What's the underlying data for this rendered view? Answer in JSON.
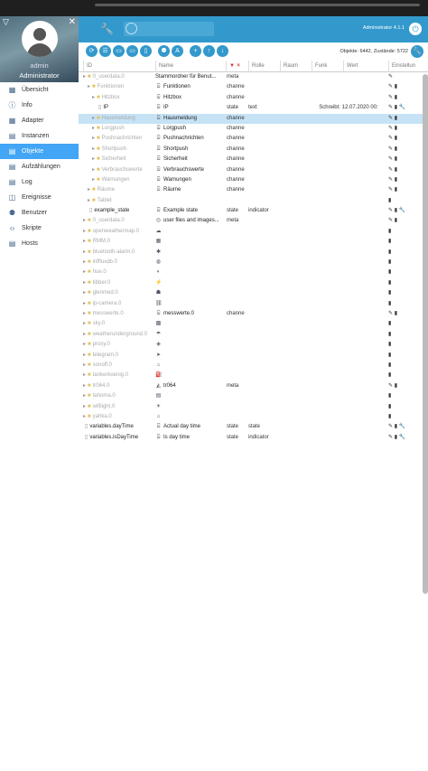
{
  "sidebar": {
    "user": "admin",
    "role": "Administrator",
    "items": [
      {
        "label": "Übersicht",
        "icon": "overview-icon"
      },
      {
        "label": "Info",
        "icon": "info-icon"
      },
      {
        "label": "Adapter",
        "icon": "adapter-icon"
      },
      {
        "label": "Instanzen",
        "icon": "instances-icon"
      },
      {
        "label": "Objekte",
        "icon": "objects-icon"
      },
      {
        "label": "Aufzählungen",
        "icon": "enums-icon"
      },
      {
        "label": "Log",
        "icon": "log-icon"
      },
      {
        "label": "Ereignisse",
        "icon": "events-icon"
      },
      {
        "label": "Benutzer",
        "icon": "users-icon"
      },
      {
        "label": "Skripte",
        "icon": "scripts-icon"
      },
      {
        "label": "Hosts",
        "icon": "hosts-icon"
      }
    ],
    "active_index": 4
  },
  "appbar": {
    "search_placeholder": "",
    "version": "Administrator 4.1.1"
  },
  "toolbar": {
    "object_count": "Objekte: 6442, Zustände: 5722"
  },
  "table": {
    "columns": [
      "ID",
      "Name",
      "▼ ✕",
      "Rolle",
      "Raum",
      "Funk",
      "Wert",
      "Einstellun"
    ],
    "rows": [
      {
        "id": "0_userdata.0",
        "name": "Stammordner für Benut...",
        "type": "meta",
        "role": "",
        "val": "",
        "acts": "✎"
      },
      {
        "id": "Funktionen",
        "name": "Funktionen",
        "type": "channe",
        "role": "",
        "val": "",
        "acts": "✎ ▮"
      },
      {
        "id": "Hitzbox",
        "name": "Hitzbox",
        "type": "channe",
        "role": "",
        "val": "",
        "acts": "✎ ▮"
      },
      {
        "id": "IP",
        "name": "IP",
        "type": "state",
        "role": "text",
        "val": "Schreibt: 12.07.2020 00:",
        "acts": "✎ ▮ 🔧"
      },
      {
        "id": "Hausmeldung",
        "name": "Hausmeldung",
        "type": "channe",
        "role": "",
        "val": "",
        "acts": "✎ ▮"
      },
      {
        "id": "Lorgpush",
        "name": "Lorgpush",
        "type": "channe",
        "role": "",
        "val": "",
        "acts": "✎ ▮"
      },
      {
        "id": "Pushnachrichten",
        "name": "Pushnachrichten",
        "type": "channe",
        "role": "",
        "val": "",
        "acts": "✎ ▮"
      },
      {
        "id": "Shortpush",
        "name": "Shortpush",
        "type": "channe",
        "role": "",
        "val": "",
        "acts": "✎ ▮"
      },
      {
        "id": "Sicherheit",
        "name": "Sicherheit",
        "type": "channe",
        "role": "",
        "val": "",
        "acts": "✎ ▮"
      },
      {
        "id": "Verbrauchswerte",
        "name": "Verbrauchswerte",
        "type": "channe",
        "role": "",
        "val": "",
        "acts": "✎ ▮"
      },
      {
        "id": "Warnungen",
        "name": "Warnungen",
        "type": "channe",
        "role": "",
        "val": "",
        "acts": "✎ ▮"
      },
      {
        "id": "Räume",
        "name": "Räume",
        "type": "channe",
        "role": "",
        "val": "",
        "acts": "✎ ▮"
      },
      {
        "id": "Tablet",
        "name": "",
        "type": "",
        "role": "",
        "val": "",
        "acts": "▮"
      },
      {
        "id": "example_state",
        "name": "Example state",
        "type": "state",
        "role": "indicator",
        "val": "",
        "acts": "✎ ▮ 🔧"
      },
      {
        "id": "0_userdata.0",
        "name": "user files and images...",
        "type": "meta",
        "role": "",
        "val": "",
        "acts": "✎ ▮"
      },
      {
        "id": "openweathermap.0",
        "name": "",
        "type": "",
        "role": "",
        "val": "",
        "acts": "▮"
      },
      {
        "id": "RMM.0",
        "name": "",
        "type": "",
        "role": "",
        "val": "",
        "acts": "▮"
      },
      {
        "id": "bluetooth-alarm.0",
        "name": "",
        "type": "",
        "role": "",
        "val": "",
        "acts": "▮"
      },
      {
        "id": "inffluxdb.0",
        "name": "",
        "type": "",
        "role": "",
        "val": "",
        "acts": "▮"
      },
      {
        "id": "hue.0",
        "name": "",
        "type": "",
        "role": "",
        "val": "",
        "acts": "▮"
      },
      {
        "id": "tibber.0",
        "name": "",
        "type": "",
        "role": "",
        "val": "",
        "acts": "▮"
      },
      {
        "id": "glenmed.0",
        "name": "",
        "type": "",
        "role": "",
        "val": "",
        "acts": "▮"
      },
      {
        "id": "ip-camera.0",
        "name": "",
        "type": "",
        "role": "",
        "val": "",
        "acts": "▮"
      },
      {
        "id": "messwerte.0",
        "name": "messwerte.0",
        "type": "channe",
        "role": "",
        "val": "",
        "acts": "✎ ▮"
      },
      {
        "id": "sky.0",
        "name": "",
        "type": "",
        "role": "",
        "val": "",
        "acts": "▮"
      },
      {
        "id": "weatherunderground.0",
        "name": "",
        "type": "",
        "role": "",
        "val": "",
        "acts": "▮"
      },
      {
        "id": "proxy.0",
        "name": "",
        "type": "",
        "role": "",
        "val": "",
        "acts": "▮"
      },
      {
        "id": "telegram.0",
        "name": "",
        "type": "",
        "role": "",
        "val": "",
        "acts": "▮"
      },
      {
        "id": "sonoff.0",
        "name": "",
        "type": "",
        "role": "",
        "val": "",
        "acts": "▮"
      },
      {
        "id": "tankerkoenig.0",
        "name": "",
        "type": "",
        "role": "",
        "val": "",
        "acts": "▮"
      },
      {
        "id": "tr064.0",
        "name": "tr064",
        "type": "meta",
        "role": "",
        "val": "",
        "acts": "✎ ▮"
      },
      {
        "id": "tahoma.0",
        "name": "",
        "type": "",
        "role": "",
        "val": "",
        "acts": "▮"
      },
      {
        "id": "wifilight.0",
        "name": "",
        "type": "",
        "role": "",
        "val": "",
        "acts": "▮"
      },
      {
        "id": "yahka.0",
        "name": "",
        "type": "",
        "role": "",
        "val": "",
        "acts": "▮"
      },
      {
        "id": "variables.dayTime",
        "name": "Actual day time",
        "type": "state",
        "role": "state",
        "val": "",
        "acts": "✎ ▮ 🔧"
      },
      {
        "id": "variables.isDayTime",
        "name": "Is day time",
        "type": "state",
        "role": "indicator",
        "val": "",
        "acts": "✎ ▮ 🔧"
      }
    ]
  }
}
